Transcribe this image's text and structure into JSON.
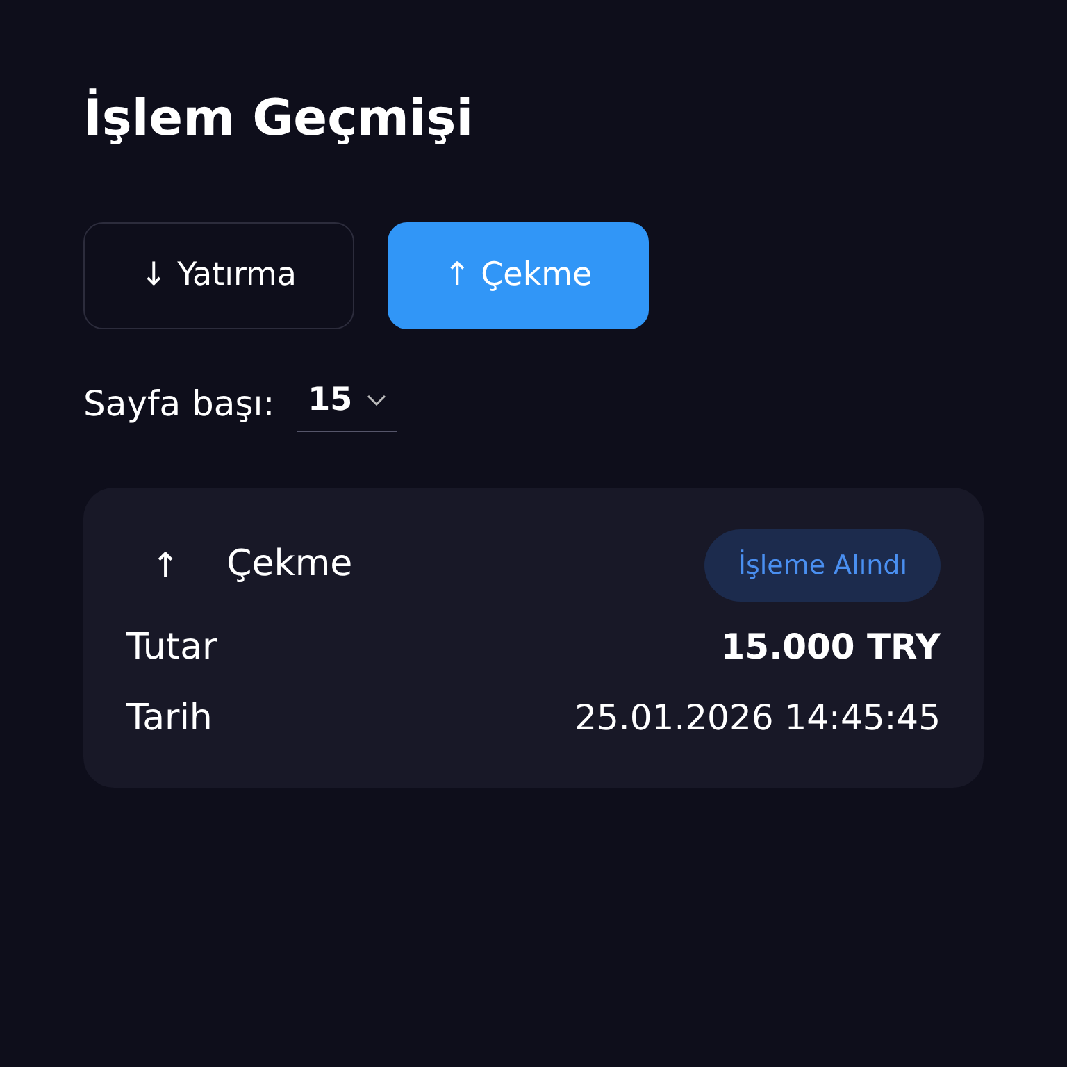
{
  "title": "İşlem Geçmişi",
  "tabs": [
    {
      "label": "↓ Yatırma",
      "selected": false
    },
    {
      "label": "↑ Çekme",
      "selected": true
    }
  ],
  "page_size": {
    "label": "Sayfa başı:",
    "value": "15"
  },
  "transactions": [
    {
      "arrow": "↑",
      "type": "Çekme",
      "status": "İşleme Alındı",
      "fields": [
        {
          "label": "Tutar",
          "value": "15.000 TRY",
          "kind": "amount"
        },
        {
          "label": "Tarih",
          "value": "25.01.2026 14:45:45",
          "kind": "date"
        }
      ]
    }
  ]
}
